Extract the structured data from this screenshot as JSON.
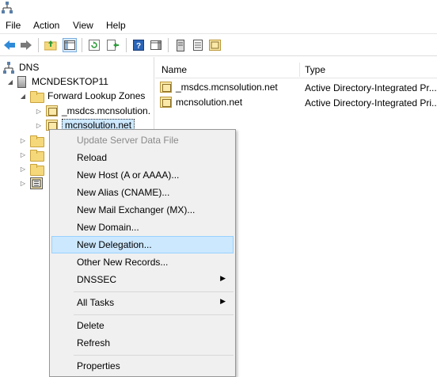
{
  "menubar": {
    "items": [
      "File",
      "Action",
      "View",
      "Help"
    ]
  },
  "tree": {
    "root": "DNS",
    "server": "MCNDESKTOP11",
    "forward_zones": "Forward Lookup Zones",
    "zone_msdcs": "_msdcs.mcnsolution.",
    "zone_main": "mcnsolution.net"
  },
  "list": {
    "columns": [
      "Name",
      "Type"
    ],
    "rows": [
      {
        "name": "_msdcs.mcnsolution.net",
        "type": "Active Directory-Integrated Pr..."
      },
      {
        "name": "mcnsolution.net",
        "type": "Active Directory-Integrated Pri..."
      }
    ]
  },
  "context_menu": {
    "items": [
      {
        "label": "Update Server Data File",
        "disabled": true
      },
      {
        "label": "Reload"
      },
      {
        "label": "New Host (A or AAAA)..."
      },
      {
        "label": "New Alias (CNAME)..."
      },
      {
        "label": "New Mail Exchanger (MX)..."
      },
      {
        "label": "New Domain..."
      },
      {
        "label": "New Delegation...",
        "highlighted": true
      },
      {
        "label": "Other New Records..."
      },
      {
        "label": "DNSSEC",
        "submenu": true
      },
      {
        "label": "All Tasks",
        "submenu": true
      },
      {
        "label": "Delete"
      },
      {
        "label": "Refresh"
      },
      {
        "label": "Properties"
      }
    ]
  },
  "colors": {
    "selection": "#cce8ff",
    "folder": "#f5d87a",
    "menu_bg": "#f0f0f0"
  }
}
